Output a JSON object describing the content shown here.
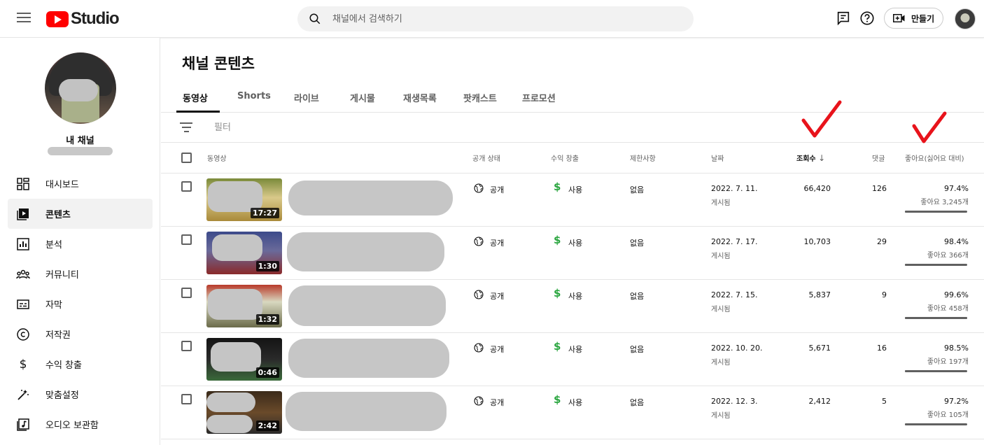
{
  "header": {
    "logo_text": "Studio",
    "search_placeholder": "채널에서 검색하기",
    "create_label": "만들기"
  },
  "sidebar": {
    "channel_title": "내 채널",
    "items": [
      {
        "label": "대시보드",
        "icon": "dashboard-icon"
      },
      {
        "label": "콘텐츠",
        "icon": "content-icon",
        "active": true
      },
      {
        "label": "분석",
        "icon": "analytics-icon"
      },
      {
        "label": "커뮤니티",
        "icon": "community-icon"
      },
      {
        "label": "자막",
        "icon": "subtitles-icon"
      },
      {
        "label": "저작권",
        "icon": "copyright-icon"
      },
      {
        "label": "수익 창출",
        "icon": "monetization-icon"
      },
      {
        "label": "맞춤설정",
        "icon": "customization-icon"
      },
      {
        "label": "오디오 보관함",
        "icon": "audio-library-icon"
      }
    ]
  },
  "main": {
    "title": "채널 콘텐츠",
    "tabs": [
      "동영상",
      "Shorts",
      "라이브",
      "게시물",
      "재생목록",
      "팟캐스트",
      "프로모션"
    ],
    "filter_placeholder": "필터",
    "columns": {
      "video": "동영상",
      "visibility": "공개 상태",
      "monetization": "수익 창출",
      "restrictions": "제한사항",
      "date": "날짜",
      "views": "조회수",
      "comments": "댓글",
      "likes": "좋아요(싫어요 대비)"
    },
    "rows": [
      {
        "duration": "17:27",
        "visibility": "공개",
        "monetization": "사용",
        "restrictions": "없음",
        "date": "2022. 7. 11.",
        "date_status": "게시됨",
        "views": "66,420",
        "comments": "126",
        "like_ratio": "97.4%",
        "like_count": "좋아요 3,245개",
        "like_fraction": 0.974
      },
      {
        "duration": "1:30",
        "visibility": "공개",
        "monetization": "사용",
        "restrictions": "없음",
        "date": "2022. 7. 17.",
        "date_status": "게시됨",
        "views": "10,703",
        "comments": "29",
        "like_ratio": "98.4%",
        "like_count": "좋아요 366개",
        "like_fraction": 0.984
      },
      {
        "duration": "1:32",
        "visibility": "공개",
        "monetization": "사용",
        "restrictions": "없음",
        "date": "2022. 7. 15.",
        "date_status": "게시됨",
        "views": "5,837",
        "comments": "9",
        "like_ratio": "99.6%",
        "like_count": "좋아요 458개",
        "like_fraction": 0.996
      },
      {
        "duration": "0:46",
        "visibility": "공개",
        "monetization": "사용",
        "restrictions": "없음",
        "date": "2022. 10. 20.",
        "date_status": "게시됨",
        "views": "5,671",
        "comments": "16",
        "like_ratio": "98.5%",
        "like_count": "좋아요 197개",
        "like_fraction": 0.985
      },
      {
        "duration": "2:42",
        "visibility": "공개",
        "monetization": "사용",
        "restrictions": "없음",
        "date": "2022. 12. 3.",
        "date_status": "게시됨",
        "views": "2,412",
        "comments": "5",
        "like_ratio": "97.2%",
        "like_count": "좋아요 105개",
        "like_fraction": 0.972
      }
    ]
  },
  "colors": {
    "brand_red": "#ff0000",
    "monetization_green": "#2ba640",
    "annotation_red": "#e8131b"
  }
}
